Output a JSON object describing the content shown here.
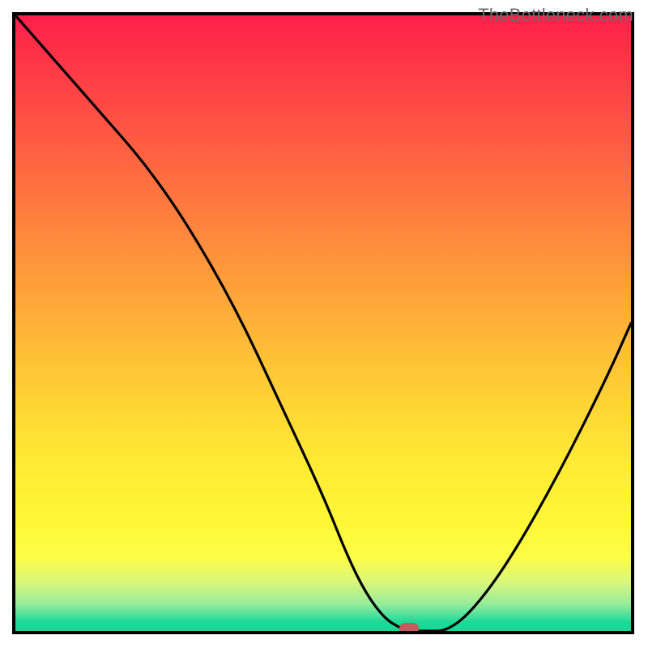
{
  "watermark": "TheBottleneck.com",
  "chart_data": {
    "type": "line",
    "title": "",
    "xlabel": "",
    "ylabel": "",
    "xlim": [
      0,
      100
    ],
    "ylim": [
      0,
      100
    ],
    "x": [
      0,
      7,
      14,
      21,
      28,
      36,
      43,
      50,
      54,
      57,
      60,
      62.5,
      64,
      67,
      70,
      74,
      80,
      88,
      96,
      100
    ],
    "values": [
      100,
      92,
      84,
      76,
      66,
      52,
      37,
      22,
      12,
      6,
      2,
      0.5,
      0,
      0,
      0,
      3,
      11,
      25,
      41,
      50
    ],
    "note": "Bottleneck curve; y is percentage bottleneck (approx), x is relative component position. Values estimated from pixel positions against 0-100 normalized axes.",
    "marker": {
      "x": 64,
      "y": 0
    },
    "gradient_colors": {
      "top": "#ff1f4a",
      "mid_upper": "#ff893d",
      "mid": "#ffd435",
      "mid_lower": "#fdfd46",
      "bottom": "#18d897"
    }
  }
}
